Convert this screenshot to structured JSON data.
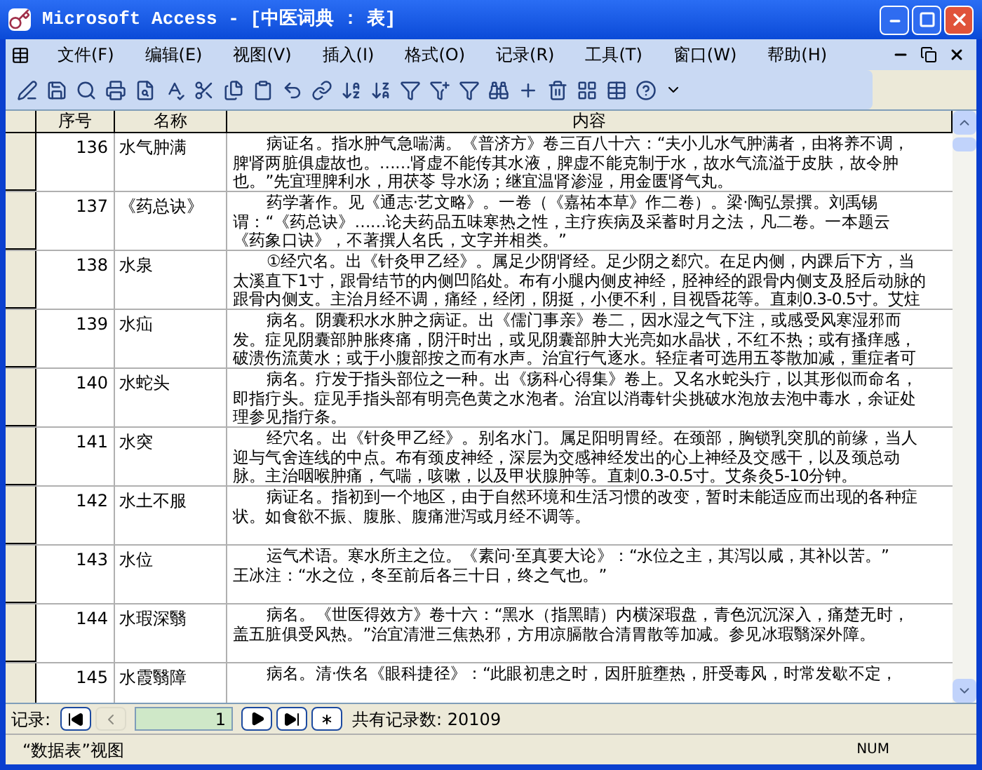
{
  "window": {
    "title": "Microsoft Access - [中医词典 : 表]"
  },
  "menu": [
    "文件(F)",
    "编辑(E)",
    "视图(V)",
    "插入(I)",
    "格式(O)",
    "记录(R)",
    "工具(T)",
    "窗口(W)",
    "帮助(H)"
  ],
  "grid": {
    "columns": [
      "序号",
      "名称",
      "内容"
    ],
    "rows": [
      {
        "id": "136",
        "name": "水气肿满",
        "lines": [
          "病证名。指水肿气急喘满。《普济方》卷三百八十六：“夫小儿水气肿满者，由将养不调，",
          "脾肾两脏俱虚故也。……肾虚不能传其水液，脾虚不能克制于水，故水气流溢于皮肤，故令肿",
          "也。”先宜理脾利水，用茯苓  导水汤；继宜温肾渗湿，用金匮肾气丸。"
        ]
      },
      {
        "id": "137",
        "name": "《药总诀》",
        "lines": [
          "药学著作。见《通志·艺文略》。一卷（《嘉祐本草》作二卷）。梁·陶弘景撰。刘禹锡",
          "谓：“《药总诀》……论夫药品五味寒热之性，主疗疾病及采蓄时月之法，凡二卷。一本题云",
          "《药象口诀》，不著撰人名氏，文字并相类。”"
        ]
      },
      {
        "id": "138",
        "name": "水泉",
        "lines": [
          "①经穴名。出《针灸甲乙经》。属足少阴肾经。足少阴之郄穴。在足内侧，内踝后下方，当",
          "太溪直下1寸，跟骨结节的内侧凹陷处。布有小腿内侧皮神经，胫神经的跟骨内侧支及胫后动脉的",
          "跟骨内侧支。主治月经不调，痛经，经闭，阴挺，小便不利，目视昏花等。直刺0.3-0.5寸。艾炷"
        ]
      },
      {
        "id": "139",
        "name": "水疝",
        "lines": [
          "病名。阴囊积水水肿之病证。出《儒门事亲》卷二，因水湿之气下注，或感受风寒湿邪而",
          "发。症见阴囊部肿胀疼痛，阴汗时出，或见阴囊部肿大光亮如水晶状，不红不热；或有搔痒感，",
          "破溃伤流黄水；或于小腹部按之而有水声。治宜行气逐水。轻症者可选用五苓散加减，重症者可"
        ]
      },
      {
        "id": "140",
        "name": "水蛇头",
        "lines": [
          "病名。疔发于指头部位之一种。出《疡科心得集》卷上。又名水蛇头疔，以其形似而命名，",
          "即指疔头。症见手指头部有明亮色黄之水泡者。治宜以消毒针尖挑破水泡放去泡中毒水，余证处",
          "理参见指疔条。"
        ]
      },
      {
        "id": "141",
        "name": "水突",
        "lines": [
          "经穴名。出《针灸甲乙经》。别名水门。属足阳明胃经。在颈部，胸锁乳突肌的前缘，当人",
          "迎与气舍连线的中点。布有颈皮神经，深层为交感神经发出的心上神经及交感干，以及颈总动",
          "脉。主治咽喉肿痛，气喘，咳嗽，以及甲状腺肿等。直刺0.3-0.5寸。艾条灸5-10分钟。"
        ]
      },
      {
        "id": "142",
        "name": "水土不服",
        "lines": [
          "病证名。指初到一个地区，由于自然环境和生活习惯的改变，暂时未能适应而出现的各种症",
          "状。如食欲不振、腹胀、腹痛泄泻或月经不调等。"
        ]
      },
      {
        "id": "143",
        "name": "水位",
        "lines": [
          "运气术语。寒水所主之位。《素问·至真要大论》：“水位之主，其泻以咸，其补以苦。”",
          "王冰注：“水之位，冬至前后各三十日，终之气也。”"
        ]
      },
      {
        "id": "144",
        "name": "水瑕深翳",
        "lines": [
          "病名。《世医得效方》卷十六：“黑水（指黑睛）内横深瑕盘，青色沉沉深入，痛楚无时，",
          "盖五脏俱受风热。”治宜清泄三焦热邪，方用凉膈散合清胃散等加减。参见冰瑕翳深外障。"
        ]
      },
      {
        "id": "145",
        "name": "水霞翳障",
        "lines": [
          "病名。清·佚名《眼科捷径》：“此眼初患之时，因肝脏壅热，肝受毒风，时常发歇不定，"
        ]
      }
    ]
  },
  "navigator": {
    "label": "记录:",
    "current": "1",
    "total": "共有记录数: 20109",
    "buttons": [
      {
        "kind": "first",
        "disabled": false
      },
      {
        "kind": "prev",
        "disabled": true
      },
      {
        "kind": "next",
        "disabled": false
      },
      {
        "kind": "last",
        "disabled": false
      },
      {
        "kind": "new",
        "disabled": false
      }
    ]
  },
  "status_bar": {
    "text": "“数据表”视图",
    "indicator": "NUM"
  }
}
